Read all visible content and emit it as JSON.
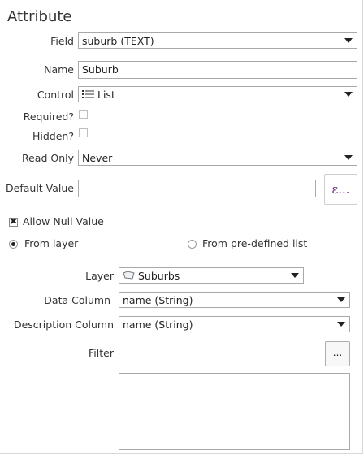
{
  "title": "Attribute",
  "field": {
    "label": "Field",
    "value": "suburb (TEXT)"
  },
  "name": {
    "label": "Name",
    "value": "Suburb"
  },
  "control": {
    "label": "Control",
    "value": "List"
  },
  "required": {
    "label": "Required?"
  },
  "hidden": {
    "label": "Hidden?"
  },
  "read_only": {
    "label": "Read Only",
    "value": "Never"
  },
  "default_value": {
    "label": "Default Value",
    "value": "",
    "expr_button": "ε..."
  },
  "allow_null": {
    "label": "Allow Null Value",
    "checked": true
  },
  "source": {
    "from_layer": "From layer",
    "from_list": "From pre-defined list",
    "selected": "From layer"
  },
  "layer": {
    "label": "Layer",
    "value": "Suburbs"
  },
  "data_column": {
    "label": "Data Column",
    "value": "name (String)"
  },
  "description_column": {
    "label": "Description Column",
    "value": "name (String)"
  },
  "filter": {
    "label": "Filter",
    "button": "..."
  },
  "icons": {
    "control": "list-icon",
    "layer": "polygon-layer-icon",
    "allow_null": "checkbox-x-icon"
  }
}
